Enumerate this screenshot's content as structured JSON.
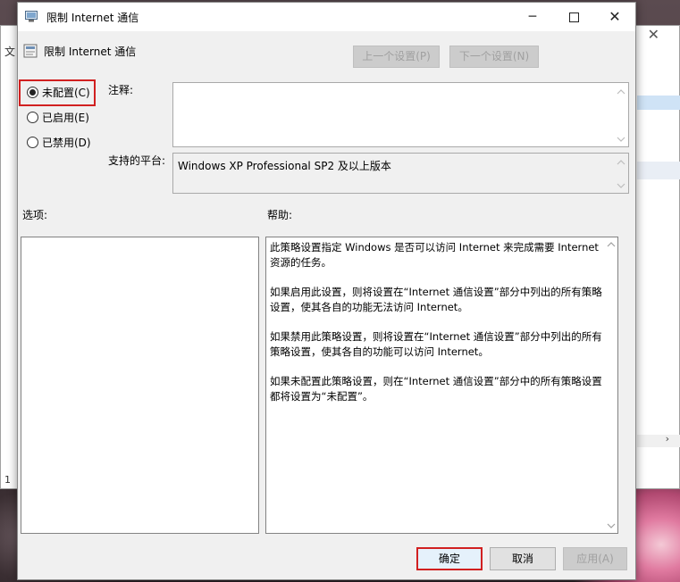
{
  "window": {
    "title": "限制 Internet 通信",
    "minimize_glyph": "─",
    "close_glyph": "✕"
  },
  "parent": {
    "close_glyph": "✕",
    "menu_fragment": "文",
    "status_fragment": "1",
    "scroll_right_glyph": "›"
  },
  "policy": {
    "title": "限制 Internet 通信",
    "prev_label": "上一个设置(P)",
    "next_label": "下一个设置(N)"
  },
  "state": {
    "options": [
      {
        "label": "未配置(C)",
        "checked": true
      },
      {
        "label": "已启用(E)",
        "checked": false
      },
      {
        "label": "已禁用(D)",
        "checked": false
      }
    ]
  },
  "comment": {
    "label": "注释:",
    "value": ""
  },
  "platform": {
    "label": "支持的平台:",
    "value": "Windows XP Professional SP2 及以上版本"
  },
  "options_section": {
    "label": "选项:"
  },
  "help": {
    "label": "帮助:",
    "paragraphs": [
      "此策略设置指定 Windows 是否可以访问 Internet 来完成需要 Internet 资源的任务。",
      "如果启用此设置，则将设置在“Internet 通信设置”部分中列出的所有策略设置，使其各自的功能无法访问 Internet。",
      "如果禁用此策略设置，则将设置在“Internet 通信设置”部分中列出的所有策略设置，使其各自的功能可以访问 Internet。",
      "如果未配置此策略设置，则在“Internet 通信设置”部分中的所有策略设置都将设置为“未配置”。"
    ]
  },
  "footer": {
    "ok_label": "确定",
    "cancel_label": "取消",
    "apply_label": "应用(A)"
  },
  "colors": {
    "highlight": "#d12020",
    "dialog_bg": "#f0f0f0"
  }
}
